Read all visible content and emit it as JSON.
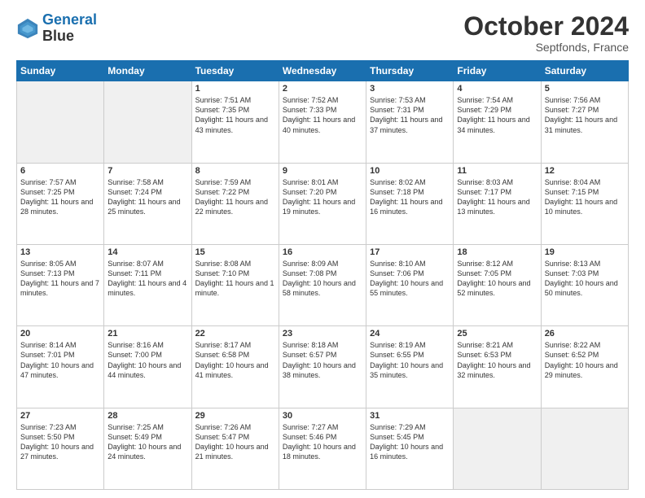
{
  "header": {
    "logo_line1": "General",
    "logo_line2": "Blue",
    "month": "October 2024",
    "location": "Septfonds, France"
  },
  "weekdays": [
    "Sunday",
    "Monday",
    "Tuesday",
    "Wednesday",
    "Thursday",
    "Friday",
    "Saturday"
  ],
  "weeks": [
    [
      {
        "day": "",
        "info": ""
      },
      {
        "day": "",
        "info": ""
      },
      {
        "day": "1",
        "info": "Sunrise: 7:51 AM\nSunset: 7:35 PM\nDaylight: 11 hours and 43 minutes."
      },
      {
        "day": "2",
        "info": "Sunrise: 7:52 AM\nSunset: 7:33 PM\nDaylight: 11 hours and 40 minutes."
      },
      {
        "day": "3",
        "info": "Sunrise: 7:53 AM\nSunset: 7:31 PM\nDaylight: 11 hours and 37 minutes."
      },
      {
        "day": "4",
        "info": "Sunrise: 7:54 AM\nSunset: 7:29 PM\nDaylight: 11 hours and 34 minutes."
      },
      {
        "day": "5",
        "info": "Sunrise: 7:56 AM\nSunset: 7:27 PM\nDaylight: 11 hours and 31 minutes."
      }
    ],
    [
      {
        "day": "6",
        "info": "Sunrise: 7:57 AM\nSunset: 7:25 PM\nDaylight: 11 hours and 28 minutes."
      },
      {
        "day": "7",
        "info": "Sunrise: 7:58 AM\nSunset: 7:24 PM\nDaylight: 11 hours and 25 minutes."
      },
      {
        "day": "8",
        "info": "Sunrise: 7:59 AM\nSunset: 7:22 PM\nDaylight: 11 hours and 22 minutes."
      },
      {
        "day": "9",
        "info": "Sunrise: 8:01 AM\nSunset: 7:20 PM\nDaylight: 11 hours and 19 minutes."
      },
      {
        "day": "10",
        "info": "Sunrise: 8:02 AM\nSunset: 7:18 PM\nDaylight: 11 hours and 16 minutes."
      },
      {
        "day": "11",
        "info": "Sunrise: 8:03 AM\nSunset: 7:17 PM\nDaylight: 11 hours and 13 minutes."
      },
      {
        "day": "12",
        "info": "Sunrise: 8:04 AM\nSunset: 7:15 PM\nDaylight: 11 hours and 10 minutes."
      }
    ],
    [
      {
        "day": "13",
        "info": "Sunrise: 8:05 AM\nSunset: 7:13 PM\nDaylight: 11 hours and 7 minutes."
      },
      {
        "day": "14",
        "info": "Sunrise: 8:07 AM\nSunset: 7:11 PM\nDaylight: 11 hours and 4 minutes."
      },
      {
        "day": "15",
        "info": "Sunrise: 8:08 AM\nSunset: 7:10 PM\nDaylight: 11 hours and 1 minute."
      },
      {
        "day": "16",
        "info": "Sunrise: 8:09 AM\nSunset: 7:08 PM\nDaylight: 10 hours and 58 minutes."
      },
      {
        "day": "17",
        "info": "Sunrise: 8:10 AM\nSunset: 7:06 PM\nDaylight: 10 hours and 55 minutes."
      },
      {
        "day": "18",
        "info": "Sunrise: 8:12 AM\nSunset: 7:05 PM\nDaylight: 10 hours and 52 minutes."
      },
      {
        "day": "19",
        "info": "Sunrise: 8:13 AM\nSunset: 7:03 PM\nDaylight: 10 hours and 50 minutes."
      }
    ],
    [
      {
        "day": "20",
        "info": "Sunrise: 8:14 AM\nSunset: 7:01 PM\nDaylight: 10 hours and 47 minutes."
      },
      {
        "day": "21",
        "info": "Sunrise: 8:16 AM\nSunset: 7:00 PM\nDaylight: 10 hours and 44 minutes."
      },
      {
        "day": "22",
        "info": "Sunrise: 8:17 AM\nSunset: 6:58 PM\nDaylight: 10 hours and 41 minutes."
      },
      {
        "day": "23",
        "info": "Sunrise: 8:18 AM\nSunset: 6:57 PM\nDaylight: 10 hours and 38 minutes."
      },
      {
        "day": "24",
        "info": "Sunrise: 8:19 AM\nSunset: 6:55 PM\nDaylight: 10 hours and 35 minutes."
      },
      {
        "day": "25",
        "info": "Sunrise: 8:21 AM\nSunset: 6:53 PM\nDaylight: 10 hours and 32 minutes."
      },
      {
        "day": "26",
        "info": "Sunrise: 8:22 AM\nSunset: 6:52 PM\nDaylight: 10 hours and 29 minutes."
      }
    ],
    [
      {
        "day": "27",
        "info": "Sunrise: 7:23 AM\nSunset: 5:50 PM\nDaylight: 10 hours and 27 minutes."
      },
      {
        "day": "28",
        "info": "Sunrise: 7:25 AM\nSunset: 5:49 PM\nDaylight: 10 hours and 24 minutes."
      },
      {
        "day": "29",
        "info": "Sunrise: 7:26 AM\nSunset: 5:47 PM\nDaylight: 10 hours and 21 minutes."
      },
      {
        "day": "30",
        "info": "Sunrise: 7:27 AM\nSunset: 5:46 PM\nDaylight: 10 hours and 18 minutes."
      },
      {
        "day": "31",
        "info": "Sunrise: 7:29 AM\nSunset: 5:45 PM\nDaylight: 10 hours and 16 minutes."
      },
      {
        "day": "",
        "info": ""
      },
      {
        "day": "",
        "info": ""
      }
    ]
  ]
}
